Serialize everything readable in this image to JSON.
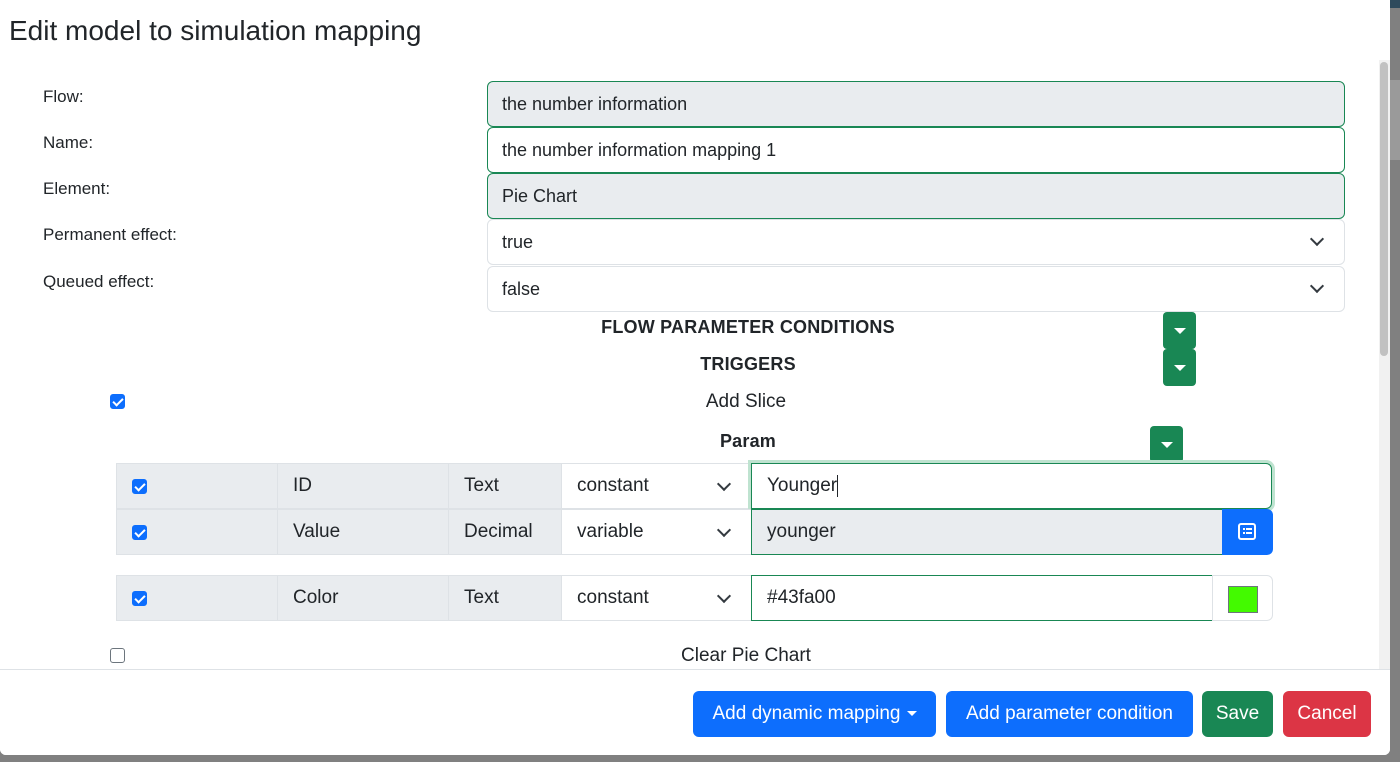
{
  "modal": {
    "title": "Edit model to simulation mapping"
  },
  "form": {
    "flow_label": "Flow:",
    "flow_value": "the number information",
    "name_label": "Name:",
    "name_value": "the number information mapping 1",
    "element_label": "Element:",
    "element_value": "Pie Chart",
    "permanent_label": "Permanent effect:",
    "permanent_value": "true",
    "queued_label": "Queued effect:",
    "queued_value": "false"
  },
  "sections": {
    "flow_param_conditions": "FLOW PARAMETER CONDITIONS",
    "triggers": "TRIGGERS",
    "param": "Param"
  },
  "triggers": [
    {
      "label": "Add Slice",
      "checked": true,
      "params": [
        {
          "checked": true,
          "name": "ID",
          "type": "Text",
          "mode": "constant",
          "value": "Younger"
        },
        {
          "checked": true,
          "name": "Value",
          "type": "Decimal",
          "mode": "variable",
          "value": "younger"
        },
        {
          "checked": true,
          "name": "Color",
          "type": "Text",
          "mode": "constant",
          "value": "#43fa00"
        }
      ]
    },
    {
      "label": "Clear Pie Chart",
      "checked": false
    }
  ],
  "colors": {
    "swatch": "#43fa00",
    "primary": "#0d6efd",
    "success": "#198754",
    "danger": "#dc3545"
  },
  "footer": {
    "add_dynamic_mapping": "Add dynamic mapping",
    "add_parameter_condition": "Add parameter condition",
    "save": "Save",
    "cancel": "Cancel"
  }
}
